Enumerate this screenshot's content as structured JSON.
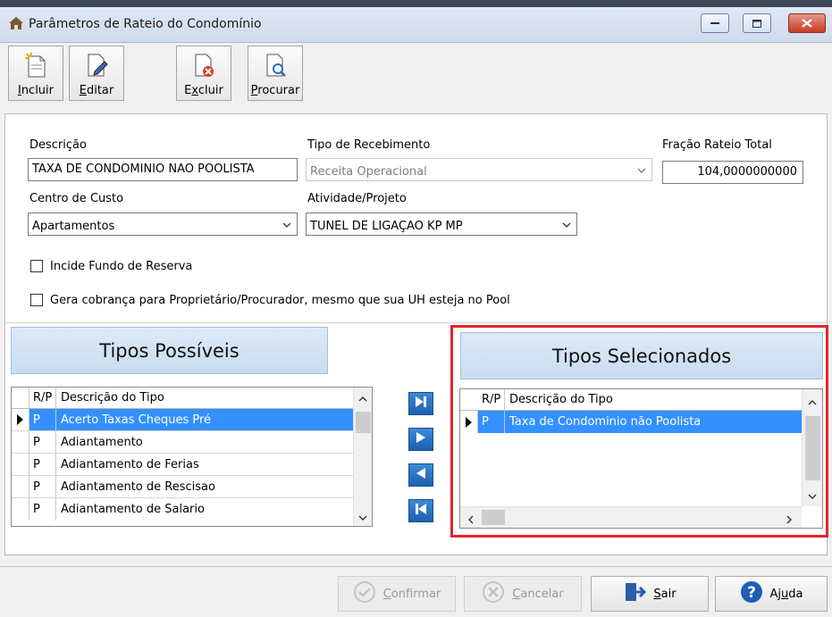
{
  "window": {
    "title": "Parâmetros de Rateio do Condomínio"
  },
  "toolbar": [
    {
      "key": "I",
      "rest": "ncluir"
    },
    {
      "key": "E",
      "rest": "ditar"
    },
    {
      "key": "Ex",
      "rest": "cluir",
      "full": "Excluir"
    },
    {
      "key": "P",
      "rest": "rocurar"
    }
  ],
  "form": {
    "descricao_label": "Descrição",
    "descricao_value": "TAXA DE CONDOMINIO NAO POOLISTA",
    "tipo_recebimento_label": "Tipo de Recebimento",
    "tipo_recebimento_value": "Receita Operacional",
    "fracao_label": "Fração Rateio Total",
    "fracao_value": "104,0000000000",
    "centro_custo_label": "Centro de Custo",
    "centro_custo_value": "Apartamentos",
    "atividade_label": "Atividade/Projeto",
    "atividade_value": "TUNEL DE LIGAÇAO KP MP",
    "incide_fundo_label": "Incide Fundo de Reserva",
    "gera_cobranca_label": "Gera cobrança para Proprietário/Procurador, mesmo que sua UH esteja no Pool"
  },
  "possiveis": {
    "header": "Tipos Possíveis",
    "col_rp": "R/P",
    "col_desc": "Descrição do Tipo",
    "rows": [
      {
        "rp": "P",
        "desc": "Acerto Taxas Cheques Pré"
      },
      {
        "rp": "P",
        "desc": "Adiantamento"
      },
      {
        "rp": "P",
        "desc": "Adiantamento de Ferias"
      },
      {
        "rp": "P",
        "desc": "Adiantamento de Rescisao"
      },
      {
        "rp": "P",
        "desc": "Adiantamento de Salario"
      }
    ]
  },
  "selecionados": {
    "header": "Tipos Selecionados",
    "col_rp": "R/P",
    "col_desc": "Descrição do Tipo",
    "rows": [
      {
        "rp": "P",
        "desc": "Taxa de Condominio não Poolista"
      }
    ]
  },
  "buttons": {
    "confirmar": {
      "key": "C",
      "rest": "onfirmar"
    },
    "cancelar": {
      "key": "C",
      "rest": "ancelar"
    },
    "sair": {
      "key": "S",
      "rest": "air"
    },
    "ajuda": {
      "pre": "Aj",
      "key": "u",
      "rest": "da"
    }
  },
  "colors": {
    "highlight_border": "#e3242b",
    "selection": "#3390ff",
    "nav_arrow": "#1f66b8"
  }
}
